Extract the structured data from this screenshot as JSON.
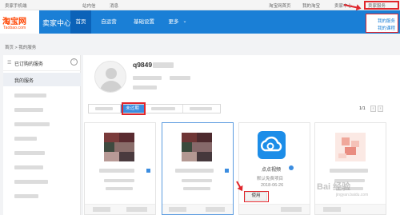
{
  "topbar": {
    "seller_phone": "卖家手机端",
    "messages": "站内信",
    "notice": "消息",
    "taobao_home": "淘宝网首页",
    "my_taobao": "我的淘宝",
    "seller_center": "卖家中心",
    "seller_service": "卖家服务"
  },
  "header": {
    "logo_text": "淘宝网",
    "logo_sub": "Taobao.com",
    "title": "卖家中心",
    "nav": [
      "首页",
      "自运营",
      "基础设置",
      "更多"
    ],
    "more_chevron": "⌄"
  },
  "dropdown": {
    "items": [
      "我的服务",
      "我的课程"
    ]
  },
  "breadcrumb": "首页 > 我的服务",
  "sidebar": {
    "group_title": "已订购的服务",
    "selected_item": "我的服务"
  },
  "profile": {
    "username": "q9849"
  },
  "tabs": {
    "active_label": "未过期"
  },
  "pager": {
    "text": "1/1",
    "prev": "‹",
    "next": "›"
  },
  "app_card": {
    "name": "点点视频",
    "subtitle": "默认免费项目",
    "date": "2018-06-26",
    "button": "使用"
  },
  "watermark": {
    "text": "Bai 经验",
    "sub": "jingyan.baidu.com"
  },
  "colors": {
    "brand_blue": "#1a7fd6",
    "highlight_red": "#e0262c",
    "taobao_orange": "#ff4400"
  }
}
